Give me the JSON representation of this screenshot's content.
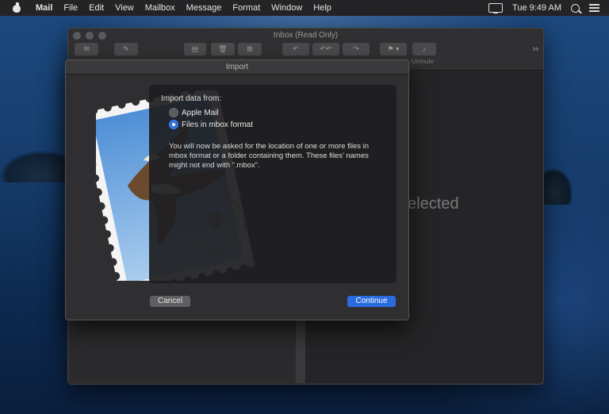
{
  "menubar": {
    "items": [
      "Mail",
      "File",
      "Edit",
      "View",
      "Mailbox",
      "Message",
      "Format",
      "Window",
      "Help"
    ],
    "clock": "Tue 9:49 AM"
  },
  "mail_window": {
    "title": "Inbox (Read Only)",
    "toolbar_labels": {
      "unmute": "Unmute"
    },
    "no_message_text": "No Message Selected"
  },
  "import_sheet": {
    "title": "Import",
    "import_from_label": "Import data from:",
    "options": [
      {
        "label": "Apple Mail",
        "selected": false
      },
      {
        "label": "Files in mbox format",
        "selected": true
      }
    ],
    "description": "You will now be asked for the location of one or more files in mbox format or a folder containing them. These files’ names might not end with “.mbox”.",
    "cancel_label": "Cancel",
    "continue_label": "Continue"
  },
  "colors": {
    "accent": "#2a6be0",
    "sheet_bg": "#2f2f31",
    "menubar_bg": "#242426"
  },
  "icons": [
    "apple-icon",
    "display-icon",
    "search-icon",
    "list-icon",
    "compose-icon",
    "get-mail-icon",
    "archive-icon",
    "trash-icon",
    "junk-icon",
    "reply-icon",
    "reply-all-icon",
    "forward-icon",
    "flag-icon",
    "bell-icon",
    "mail-stamp-icon"
  ]
}
